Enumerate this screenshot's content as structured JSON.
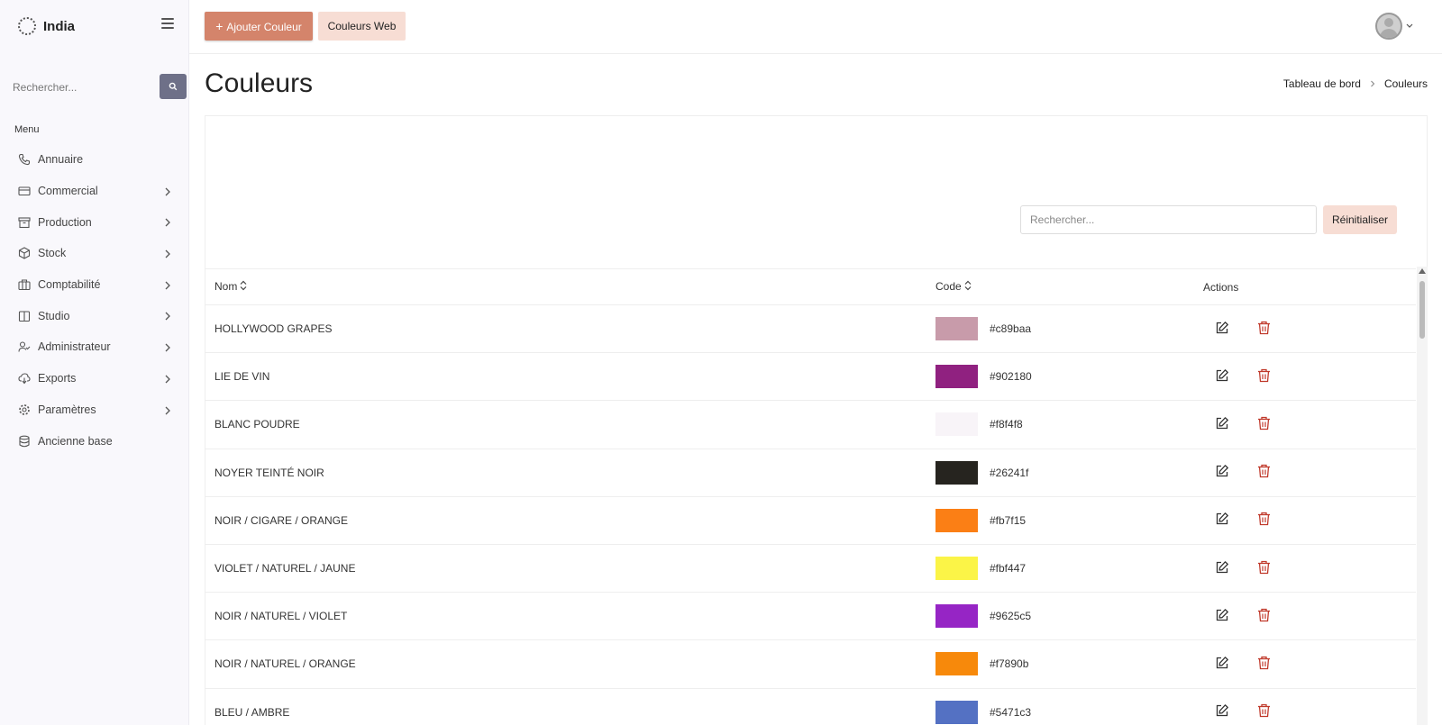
{
  "brand": {
    "name": "India"
  },
  "sidebar": {
    "search_placeholder": "Rechercher...",
    "menu_title": "Menu",
    "items": [
      {
        "label": "Annuaire",
        "icon": "phone-icon",
        "chevron": false
      },
      {
        "label": "Commercial",
        "icon": "credit-card-icon",
        "chevron": true
      },
      {
        "label": "Production",
        "icon": "archive-icon",
        "chevron": true
      },
      {
        "label": "Stock",
        "icon": "box-icon",
        "chevron": true
      },
      {
        "label": "Comptabilité",
        "icon": "briefcase-icon",
        "chevron": true
      },
      {
        "label": "Studio",
        "icon": "book-icon",
        "chevron": true
      },
      {
        "label": "Administrateur",
        "icon": "user-check-icon",
        "chevron": true
      },
      {
        "label": "Exports",
        "icon": "cloud-download-icon",
        "chevron": true
      },
      {
        "label": "Paramètres",
        "icon": "gear-icon",
        "chevron": true
      },
      {
        "label": "Ancienne base",
        "icon": "database-icon",
        "chevron": false
      }
    ]
  },
  "topbar": {
    "add_label": "Ajouter Couleur",
    "web_label": "Couleurs Web"
  },
  "header": {
    "title": "Couleurs",
    "breadcrumb": [
      "Tableau de bord",
      "Couleurs"
    ]
  },
  "filter": {
    "search_placeholder": "Rechercher...",
    "reset_label": "Réinitialiser"
  },
  "table": {
    "columns": {
      "nom": "Nom",
      "code": "Code",
      "actions": "Actions"
    },
    "rows": [
      {
        "nom": "HOLLYWOOD GRAPES",
        "code": "#c89baa"
      },
      {
        "nom": "LIE DE VIN",
        "code": "#902180"
      },
      {
        "nom": "BLANC POUDRE",
        "code": "#f8f4f8"
      },
      {
        "nom": "NOYER TEINTÉ NOIR",
        "code": "#26241f"
      },
      {
        "nom": "NOIR / CIGARE / ORANGE",
        "code": "#fb7f15"
      },
      {
        "nom": "VIOLET / NATUREL / JAUNE",
        "code": "#fbf447"
      },
      {
        "nom": "NOIR / NATUREL / VIOLET",
        "code": "#9625c5"
      },
      {
        "nom": "NOIR / NATUREL / ORANGE",
        "code": "#f7890b"
      },
      {
        "nom": "BLEU / AMBRE",
        "code": "#5471c3"
      }
    ]
  },
  "colors": {
    "accent": "#d4846b",
    "accent_light": "#f7ddd4",
    "delete": "#c0392b"
  }
}
